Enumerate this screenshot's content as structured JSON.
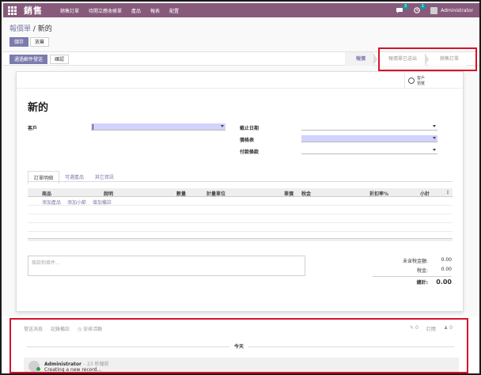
{
  "navbar": {
    "app_name": "銷售",
    "menu": [
      "銷售訂單",
      "待開立應收帳單",
      "產品",
      "報表",
      "配置"
    ],
    "messages_count": "3",
    "activities_count": "1",
    "user_name": "Administrator"
  },
  "breadcrumb": {
    "parent": "報價單",
    "separator": " / ",
    "current": "新的"
  },
  "buttons": {
    "save": "儲存",
    "discard": "放棄",
    "send_email": "通過郵件發送",
    "confirm": "確認"
  },
  "statusbar": [
    "報價",
    "報價單已送出",
    "銷售訂單"
  ],
  "smart_button": {
    "line1": "客戶",
    "line2": "預覽"
  },
  "form": {
    "title": "新的",
    "customer_label": "客戶",
    "expiration_label": "截止日期",
    "pricelist_label": "價格表",
    "payment_terms_label": "付款條款"
  },
  "tabs": [
    "訂單明細",
    "可選產品",
    "其它資訊"
  ],
  "order_lines": {
    "headers": {
      "product": "商品",
      "description": "說明",
      "quantity": "數量",
      "uom": "計量單位",
      "unit_price": "單價",
      "taxes": "稅金",
      "discount": "折扣率%",
      "subtotal": "小計"
    },
    "add_product": "添加產品",
    "add_section": "添加小節",
    "add_note": "增加備註"
  },
  "note_placeholder": "條款和條件...",
  "totals": {
    "untaxed_label": "未含稅金額:",
    "untaxed_value": "0.00",
    "tax_label": "稅金:",
    "tax_value": "0.00",
    "total_label": "總計:",
    "total_value": "0.00"
  },
  "chatter": {
    "send_message": "發送消息",
    "log_note": "記錄備註",
    "schedule_activity": "安排活動",
    "attachments_count": "0",
    "follow": "訂閱",
    "followers_count": "0",
    "today": "今天",
    "author": "Administrator",
    "time": "- 23 秒鐘前",
    "body": "Creating a new record..."
  }
}
